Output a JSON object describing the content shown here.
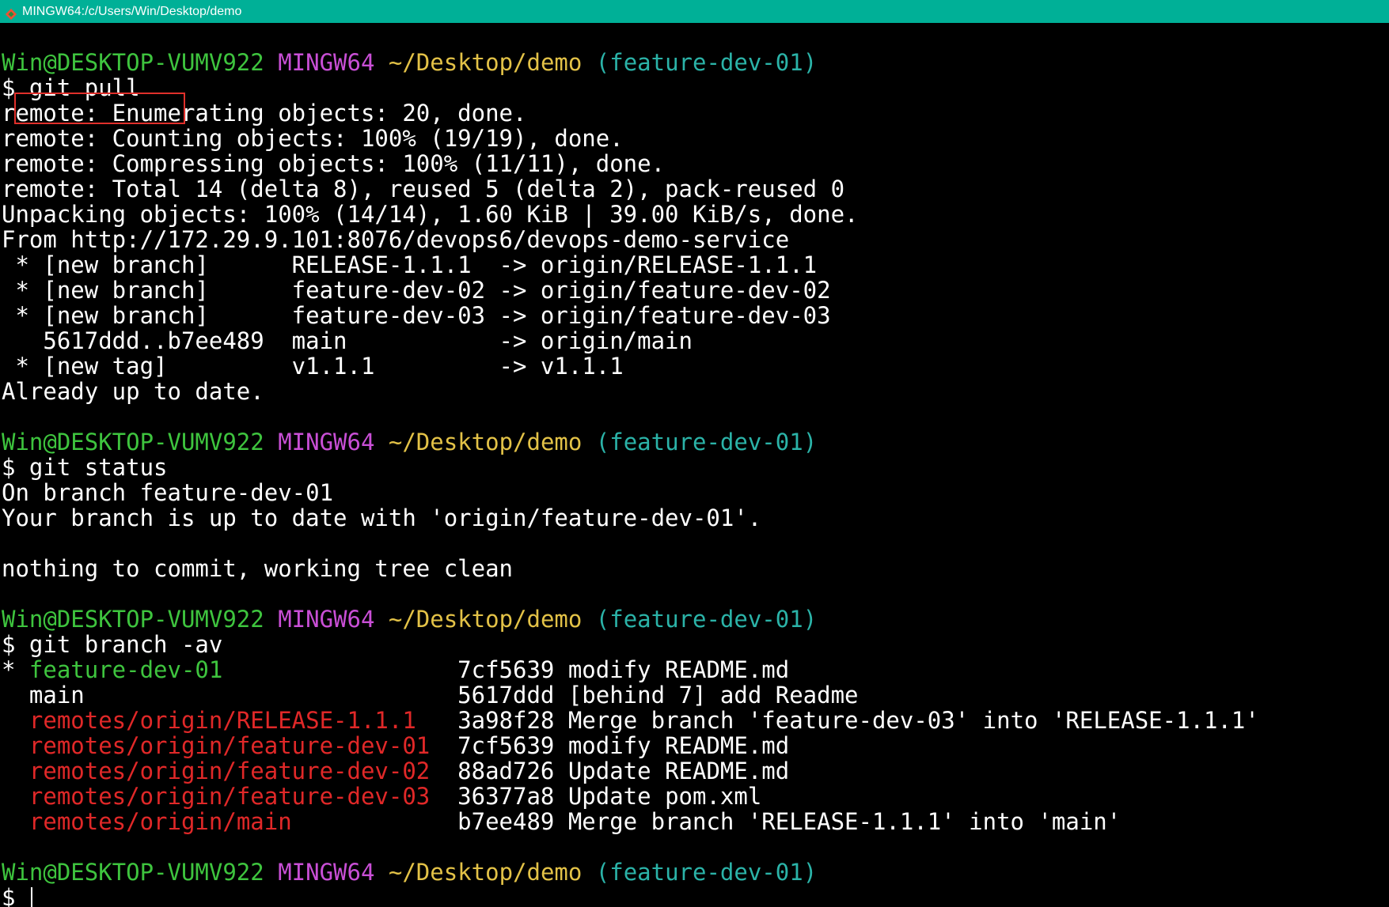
{
  "window": {
    "title": "MINGW64:/c/Users/Win/Desktop/demo"
  },
  "prompt": {
    "user": "Win@DESKTOP-VUMV922",
    "system": "MINGW64",
    "path": "~/Desktop/demo",
    "branch": "(feature-dev-01)"
  },
  "pull": {
    "command": "$ git pull",
    "output": [
      "remote: Enumerating objects: 20, done.",
      "remote: Counting objects: 100% (19/19), done.",
      "remote: Compressing objects: 100% (11/11), done.",
      "remote: Total 14 (delta 8), reused 5 (delta 2), pack-reused 0",
      "Unpacking objects: 100% (14/14), 1.60 KiB | 39.00 KiB/s, done.",
      "From http://172.29.9.101:8076/devops6/devops-demo-service",
      " * [new branch]      RELEASE-1.1.1  -> origin/RELEASE-1.1.1",
      " * [new branch]      feature-dev-02 -> origin/feature-dev-02",
      " * [new branch]      feature-dev-03 -> origin/feature-dev-03",
      "   5617ddd..b7ee489  main           -> origin/main",
      " * [new tag]         v1.1.1         -> v1.1.1",
      "Already up to date."
    ]
  },
  "status": {
    "command": "$ git status",
    "output": [
      "On branch feature-dev-01",
      "Your branch is up to date with 'origin/feature-dev-01'.",
      "",
      "nothing to commit, working tree clean"
    ]
  },
  "branch": {
    "command": "$ git branch -av",
    "rows": [
      {
        "marker": "* ",
        "name": "feature-dev-01",
        "pad": "                 ",
        "info": "7cf5639 modify README.md",
        "kind": "current"
      },
      {
        "marker": "  ",
        "name": "main",
        "pad": "                           ",
        "info": "5617ddd [behind 7] add Readme",
        "kind": "local"
      },
      {
        "marker": "  ",
        "name": "remotes/origin/RELEASE-1.1.1",
        "pad": "   ",
        "info": "3a98f28 Merge branch 'feature-dev-03' into 'RELEASE-1.1.1'",
        "kind": "remote"
      },
      {
        "marker": "  ",
        "name": "remotes/origin/feature-dev-01",
        "pad": "  ",
        "info": "7cf5639 modify README.md",
        "kind": "remote"
      },
      {
        "marker": "  ",
        "name": "remotes/origin/feature-dev-02",
        "pad": "  ",
        "info": "88ad726 Update README.md",
        "kind": "remote"
      },
      {
        "marker": "  ",
        "name": "remotes/origin/feature-dev-03",
        "pad": "  ",
        "info": "36377a8 Update pom.xml",
        "kind": "remote"
      },
      {
        "marker": "  ",
        "name": "remotes/origin/main",
        "pad": "            ",
        "info": "b7ee489 Merge branch 'RELEASE-1.1.1' into 'main'",
        "kind": "remote"
      }
    ]
  },
  "final_prompt": "$ ",
  "colors": {
    "titlebar": "#00b097",
    "user": "#3ec43e",
    "system": "#c94fd6",
    "path": "#e3c247",
    "branch": "#2bb3a8",
    "remote": "#e02828",
    "highlight": "#e0302b"
  },
  "icons": {
    "app": "git-bash-diamond-icon"
  }
}
